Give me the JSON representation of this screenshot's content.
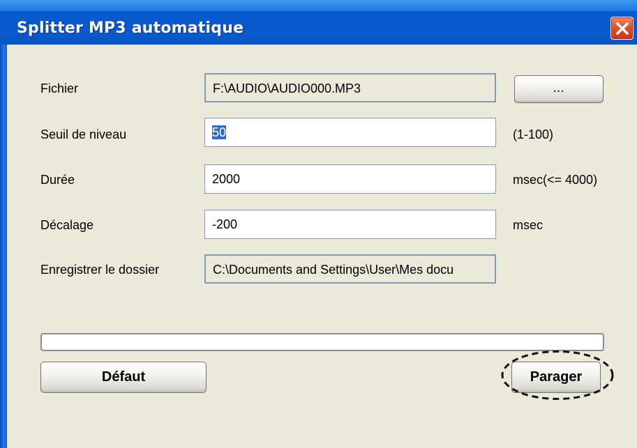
{
  "window": {
    "title": "Splitter MP3 automatique",
    "close_icon": "close-x-icon",
    "close_color": "#e0522c"
  },
  "form": {
    "file": {
      "label": "Fichier",
      "value": "F:\\AUDIO\\AUDIO000.MP3",
      "browse_label": "..."
    },
    "threshold": {
      "label": "Seuil de niveau",
      "value": "50",
      "hint": "(1-100)"
    },
    "duration": {
      "label": "Durée",
      "value": "2000",
      "hint": "msec(<= 4000)"
    },
    "offset": {
      "label": "Décalage",
      "value": "-200",
      "hint": "msec"
    },
    "save_folder": {
      "label": "Enregistrer le dossier",
      "value": "C:\\Documents and Settings\\User\\Mes docu"
    }
  },
  "progress": {
    "value": 0
  },
  "buttons": {
    "default_label": "Défaut",
    "split_label": "Parager"
  }
}
